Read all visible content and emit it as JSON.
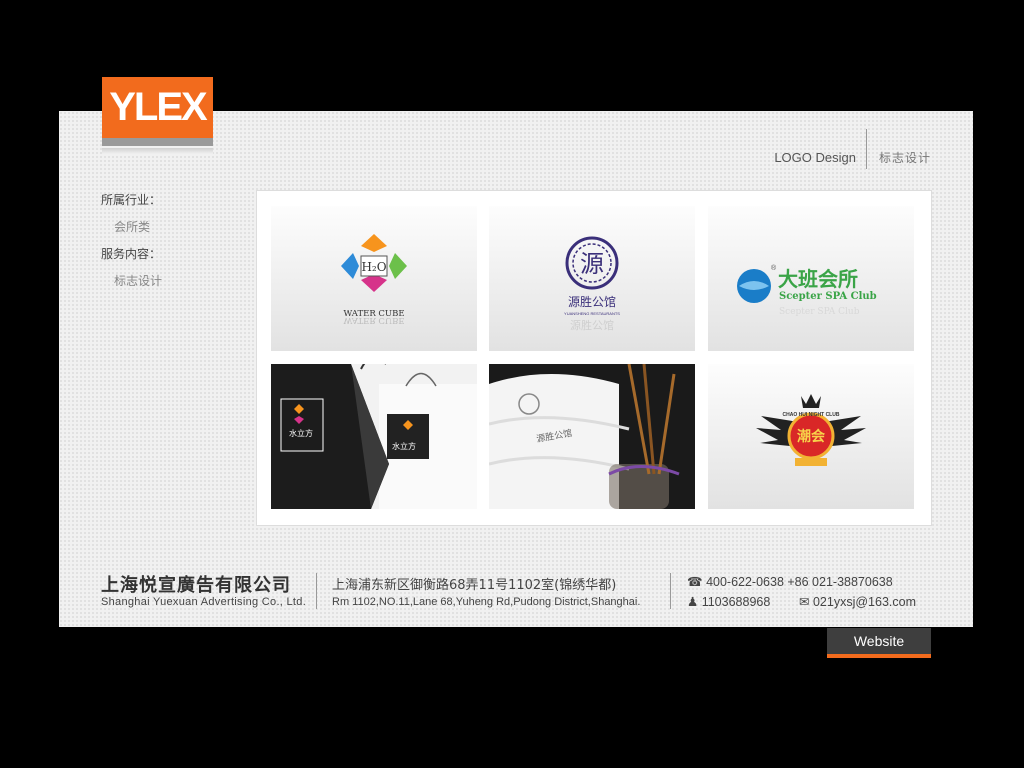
{
  "brand": {
    "logo_text": "YLEX"
  },
  "header": {
    "title_en": "LOGO Design",
    "title_zh": "标志设计"
  },
  "sidebar": {
    "industry_label": "所属行业：",
    "industry_value": "会所类",
    "service_label": "服务内容：",
    "service_value": "标志设计"
  },
  "gallery": {
    "items": [
      {
        "name": "water-cube",
        "logo_mark": "H₂O",
        "caption": "WATER CUBE"
      },
      {
        "name": "yuansheng",
        "logo_mark": "源",
        "caption": "源胜公馆",
        "subcaption": "YUANSHENG RESTAURANTS"
      },
      {
        "name": "scepter",
        "caption": "大班会所",
        "subcaption": "Scepter SPA Club",
        "mark": "®"
      },
      {
        "name": "bags-mockup",
        "caption": "水立方"
      },
      {
        "name": "towel-mockup",
        "caption": "源胜公馆"
      },
      {
        "name": "chaohui",
        "caption": "潮会",
        "subcaption": "CHAO HUI NIGHT CLUB"
      }
    ]
  },
  "footer": {
    "company_zh": "上海悦宣廣告有限公司",
    "company_en": "Shanghai  Yuexuan  Advertising  Co., Ltd.",
    "address_zh": "上海浦东新区御衡路68弄11号1102室(锦绣华都)",
    "address_en": "Rm 1102,NO.11,Lane 68,Yuheng Rd,Pudong District,Shanghai.",
    "phone": "400-622-0638   +86 021-38870638",
    "qq": "1103688968",
    "email": "021yxsj@163.com"
  },
  "website_button": "Website",
  "colors": {
    "accent": "#f26b1d",
    "panel": "#f1f1f1",
    "background": "#000000"
  }
}
